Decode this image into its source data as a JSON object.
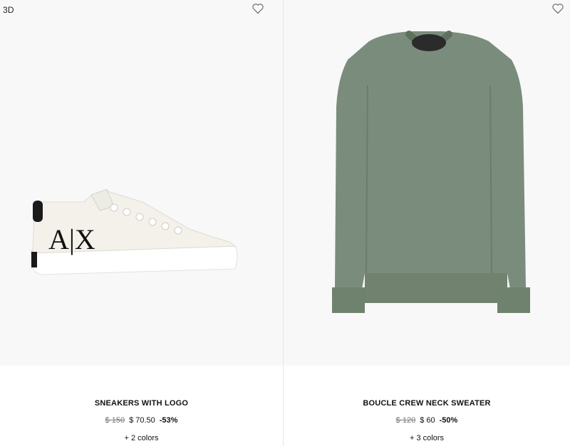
{
  "products": [
    {
      "badge": "3D",
      "image_alt": "white sneaker with black AX logo",
      "title": "SNEAKERS WITH LOGO",
      "price_old": "$ 150",
      "price_new": "$ 70.50",
      "discount": "-53%",
      "colors": "+ 2 colors",
      "logo_text": "A|X"
    },
    {
      "badge": "",
      "image_alt": "sage green knit crew neck sweater",
      "title": "BOUCLE CREW NECK SWEATER",
      "price_old": "$ 120",
      "price_new": "$ 60",
      "discount": "-50%",
      "colors": "+ 3 colors"
    }
  ],
  "colors": {
    "background": "#ffffff",
    "image_bg": "#f8f8f8",
    "sweater": "#7a8c7c",
    "sneaker": "#f2f0ea"
  },
  "icons": [
    "heart-icon",
    "heart-icon"
  ]
}
